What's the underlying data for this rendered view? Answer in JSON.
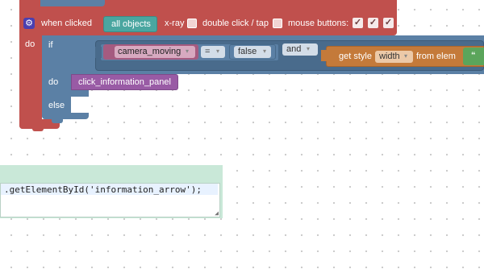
{
  "event_block": {
    "when_clicked_label": "when clicked",
    "target_label": "all objects",
    "xray_label": "x-ray",
    "double_click_label": "double click / tap",
    "mouse_buttons_label": "mouse buttons:",
    "check_glyph": "✓",
    "do_label": "do",
    "gear_glyph": "⚙"
  },
  "if_block": {
    "if_label": "if",
    "do_label": "do",
    "else_label": "else",
    "variable": "camera_moving",
    "operator": "=",
    "value": "false",
    "logic_op": "and",
    "get_style_label": "get style",
    "style_property": "width",
    "from_elem_label": "from elem",
    "quote_glyph": "“",
    "dropdown_glyph": "▾"
  },
  "procedure_call": {
    "label": "click_information_panel"
  },
  "code_panel": {
    "line": ".getElementById('information_arrow');",
    "resize_glyph": "◢"
  },
  "colors": {
    "event_red": "#c0504d",
    "if_blue": "#5b80a5",
    "variable_pink": "#a55b80",
    "procedure_purple": "#995ba5",
    "style_orange": "#c47a3a",
    "object_teal": "#4aa6a0",
    "code_bg": "#c9e8d8"
  }
}
